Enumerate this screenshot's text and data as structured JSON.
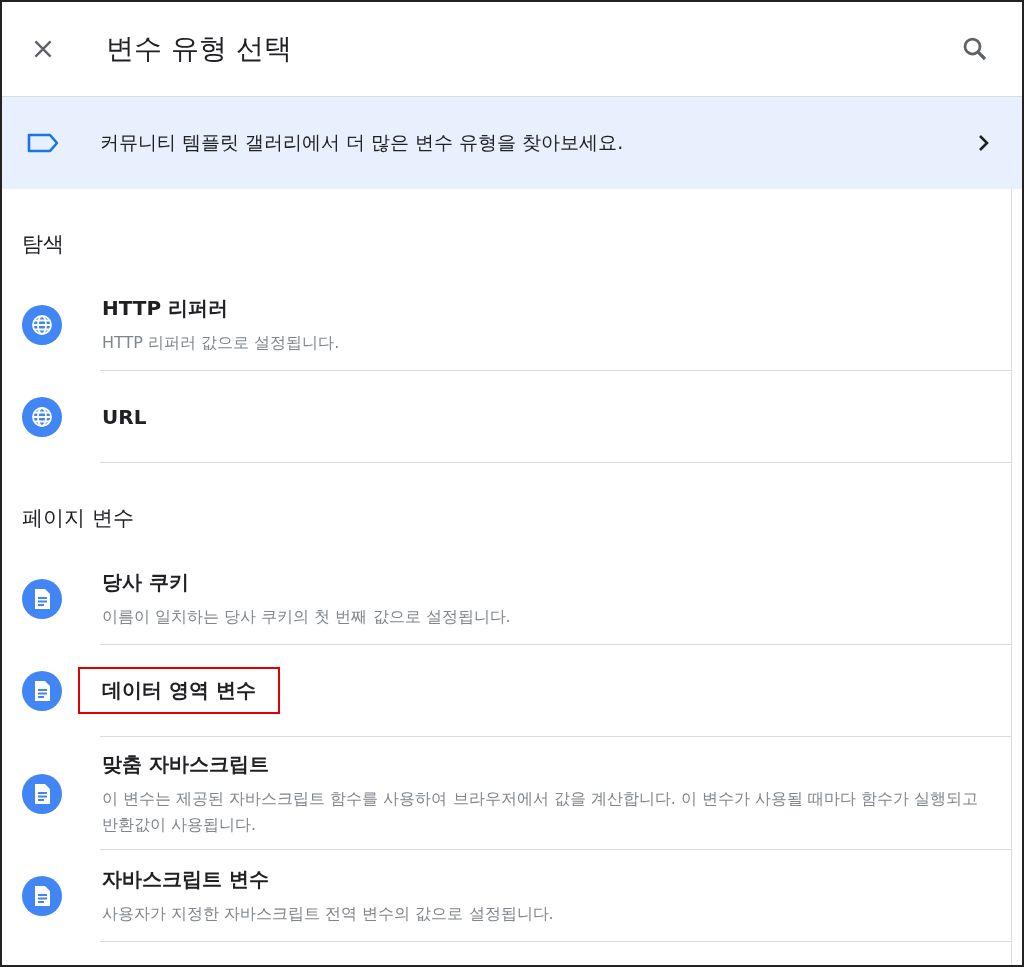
{
  "header": {
    "title": "변수 유형 선택"
  },
  "banner": {
    "text": "커뮤니티 템플릿 갤러리에서 더 많은 변수 유형을 찾아보세요."
  },
  "sections": [
    {
      "heading": "탐색",
      "items": [
        {
          "kind": "globe",
          "title": "HTTP 리퍼러",
          "description": "HTTP 리퍼러 값으로 설정됩니다.",
          "highlighted": false
        },
        {
          "kind": "globe",
          "title": "URL",
          "highlighted": false
        }
      ]
    },
    {
      "heading": "페이지 변수",
      "items": [
        {
          "kind": "document",
          "title": "당사 쿠키",
          "description": "이름이 일치하는 당사 쿠키의 첫 번째 값으로 설정됩니다.",
          "highlighted": false
        },
        {
          "kind": "document",
          "title": "데이터 영역 변수",
          "highlighted": true
        },
        {
          "kind": "document",
          "title": "맞춤 자바스크립트",
          "description": "이 변수는 제공된 자바스크립트 함수를 사용하여 브라우저에서 값을 계산합니다. 이 변수가 사용될 때마다 함수가 실행되고 반환값이 사용됩니다.",
          "highlighted": false
        },
        {
          "kind": "document",
          "title": "자바스크립트 변수",
          "description": "사용자가 지정한 자바스크립트 전역 변수의 값으로 설정됩니다.",
          "highlighted": false
        }
      ]
    }
  ]
}
